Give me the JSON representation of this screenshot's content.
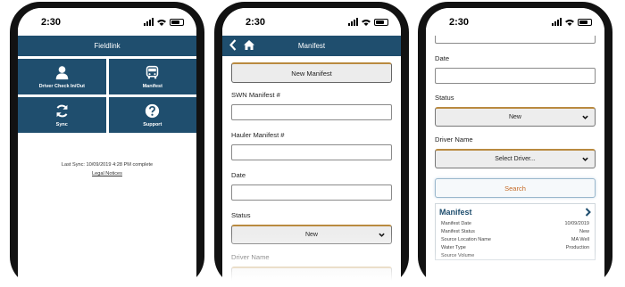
{
  "phone1": {
    "time": "2:30",
    "title": "Fieldlink",
    "tiles": [
      {
        "label": "Driver Check In/Out",
        "icon": "person-icon"
      },
      {
        "label": "Manifest",
        "icon": "truck-icon"
      },
      {
        "label": "Sync",
        "icon": "sync-icon"
      },
      {
        "label": "Support",
        "icon": "help-icon"
      }
    ],
    "last_sync": "Last Sync: 10/09/2019 4:28 PM complete",
    "legal_link": "Legal Notices"
  },
  "phone2": {
    "time": "2:30",
    "title": "Manifest",
    "new_manifest_button": "New Manifest",
    "swn_label": "SWN Manifest #",
    "hauler_label": "Hauler Manifest #",
    "date_label": "Date",
    "status_label": "Status",
    "status_value": "New",
    "driver_label": "Driver Name"
  },
  "phone3": {
    "time": "2:30",
    "date_label": "Date",
    "status_label": "Status",
    "status_value": "New",
    "driver_label": "Driver Name",
    "driver_value": "Select Driver...",
    "search_button": "Search",
    "card_title": "Manifest",
    "card_rows": [
      {
        "label": "Manifest Date",
        "value": "10/09/2019"
      },
      {
        "label": "Manifest Status",
        "value": "New"
      },
      {
        "label": "Source Location Name",
        "value": "MA Well"
      },
      {
        "label": "Water Type",
        "value": "Production"
      },
      {
        "label": "Source Volume",
        "value": ""
      }
    ]
  },
  "colors": {
    "brand": "#1f4e6e",
    "accent": "#c56a26"
  }
}
